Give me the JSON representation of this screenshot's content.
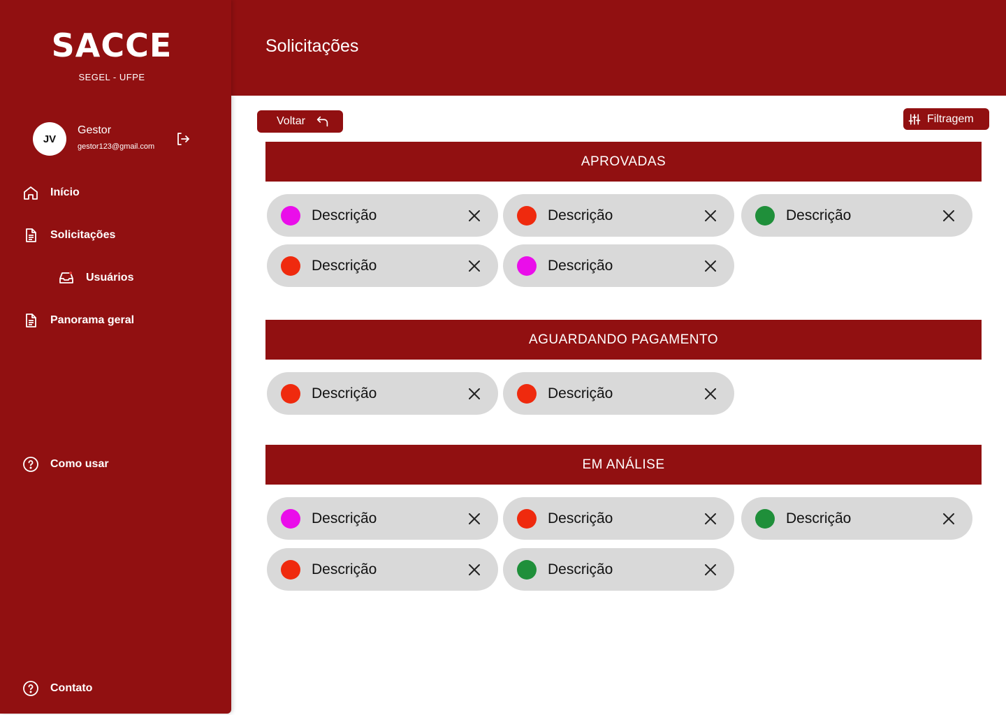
{
  "app": {
    "logo": "SACCE",
    "subtitle": "SEGEL - UFPE"
  },
  "header": {
    "title": "Solicitações"
  },
  "user": {
    "initials": "JV",
    "role": "Gestor",
    "email": "gestor123@gmail.com"
  },
  "sidebar": {
    "items": [
      {
        "label": "Início",
        "icon": "home-icon"
      },
      {
        "label": "Solicitações",
        "icon": "document-icon"
      },
      {
        "label": "Usuários",
        "icon": "inbox-icon"
      },
      {
        "label": "Panorama geral",
        "icon": "document-icon"
      },
      {
        "label": "Como usar",
        "icon": "help-icon"
      },
      {
        "label": "Contato",
        "icon": "help-icon"
      }
    ]
  },
  "toolbar": {
    "back_label": "Voltar",
    "filter_label": "Filtragem"
  },
  "colors": {
    "primary": "#911011",
    "magenta": "#ea0eea",
    "red": "#ef2a0e",
    "green": "#1f8f3a",
    "pill_bg": "#d9d9d9"
  },
  "sections": [
    {
      "title": "APROVADAS",
      "items": [
        {
          "label": "Descrição",
          "status_color": "#ea0eea"
        },
        {
          "label": "Descrição",
          "status_color": "#ef2a0e"
        },
        {
          "label": "Descrição",
          "status_color": "#1f8f3a"
        },
        {
          "label": "Descrição",
          "status_color": "#ef2a0e"
        },
        {
          "label": "Descrição",
          "status_color": "#ea0eea"
        }
      ]
    },
    {
      "title": "AGUARDANDO PAGAMENTO",
      "items": [
        {
          "label": "Descrição",
          "status_color": "#ef2a0e"
        },
        {
          "label": "Descrição",
          "status_color": "#ef2a0e"
        }
      ]
    },
    {
      "title": "EM ANÁLISE",
      "items": [
        {
          "label": "Descrição",
          "status_color": "#ea0eea"
        },
        {
          "label": "Descrição",
          "status_color": "#ef2a0e"
        },
        {
          "label": "Descrição",
          "status_color": "#1f8f3a"
        },
        {
          "label": "Descrição",
          "status_color": "#ef2a0e"
        },
        {
          "label": "Descrição",
          "status_color": "#1f8f3a"
        }
      ]
    }
  ]
}
